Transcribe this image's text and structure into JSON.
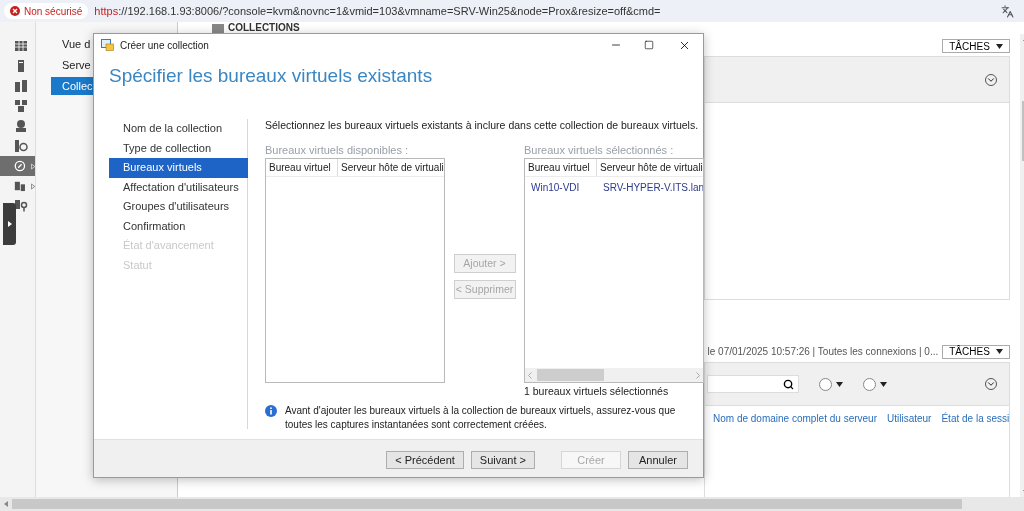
{
  "browser": {
    "security_badge": "Non sécurisé",
    "url_scheme": "https",
    "url_rest": "://192.168.1.93:8006/?console=kvm&novnc=1&vmid=103&vmname=SRV-Win25&node=Prox&resize=off&cmd="
  },
  "rail": [
    {
      "selected": false,
      "expandable": false
    },
    {
      "selected": false,
      "expandable": false
    },
    {
      "selected": false,
      "expandable": false
    },
    {
      "selected": false,
      "expandable": false
    },
    {
      "selected": false,
      "expandable": false
    },
    {
      "selected": false,
      "expandable": false
    },
    {
      "selected": true,
      "expandable": true
    },
    {
      "selected": false,
      "expandable": true
    },
    {
      "selected": false,
      "expandable": false
    }
  ],
  "nav": [
    {
      "label": "Vue d",
      "selected": false
    },
    {
      "label": "Serve",
      "selected": false
    },
    {
      "label": "Collec",
      "selected": true
    }
  ],
  "section_title": "COLLECTIONS",
  "top_panel": {
    "tasks_button": "TÂCHES"
  },
  "connections_panel": {
    "summary": "le 07/01/2025 10:57:26 | Toutes les connexions | 0...",
    "tasks_button": "TÂCHES",
    "columns": [
      "Nom de domaine complet du serveur",
      "Utilisateur",
      "État de la sessi"
    ]
  },
  "dialog": {
    "title": "Créer une collection",
    "heading": "Spécifier les bureaux virtuels existants",
    "steps": [
      {
        "label": "Nom de la collection",
        "selected": false,
        "disabled": false
      },
      {
        "label": "Type de collection",
        "selected": false,
        "disabled": false
      },
      {
        "label": "Bureaux virtuels",
        "selected": true,
        "disabled": false
      },
      {
        "label": "Affectation d'utilisateurs",
        "selected": false,
        "disabled": false
      },
      {
        "label": "Groupes d'utilisateurs",
        "selected": false,
        "disabled": false
      },
      {
        "label": "Confirmation",
        "selected": false,
        "disabled": false
      },
      {
        "label": "État d'avancement",
        "selected": false,
        "disabled": true
      },
      {
        "label": "Statut",
        "selected": false,
        "disabled": true
      }
    ],
    "description": "Sélectionnez les bureaux virtuels existants à inclure dans cette collection de bureaux virtuels.",
    "available": {
      "label": "Bureaux virtuels disponibles :",
      "columns": [
        "Bureau virtuel",
        "Serveur hôte de virtuali"
      ]
    },
    "chosen": {
      "label": "Bureaux virtuels sélectionnés :",
      "columns": [
        "Bureau virtuel",
        "Serveur hôte de virtuali"
      ],
      "rows": [
        [
          "Win10-VDI",
          "SRV-HYPER-V.ITS.lan"
        ]
      ]
    },
    "add_button": {
      "label": "Ajouter >",
      "disabled": true
    },
    "remove_button": {
      "label": "< Supprimer",
      "disabled": true
    },
    "selected_count": "1 bureaux virtuels sélectionnés",
    "info": "Avant d'ajouter les bureaux virtuels à la collection de bureaux virtuels, assurez-vous que toutes les captures instantanées sont correctement créées.",
    "nav_buttons": [
      {
        "label": "< Précédent",
        "disabled": false
      },
      {
        "label": "Suivant >",
        "disabled": false
      },
      {
        "label": "Créer",
        "disabled": true
      },
      {
        "label": "Annuler",
        "disabled": false
      }
    ]
  }
}
